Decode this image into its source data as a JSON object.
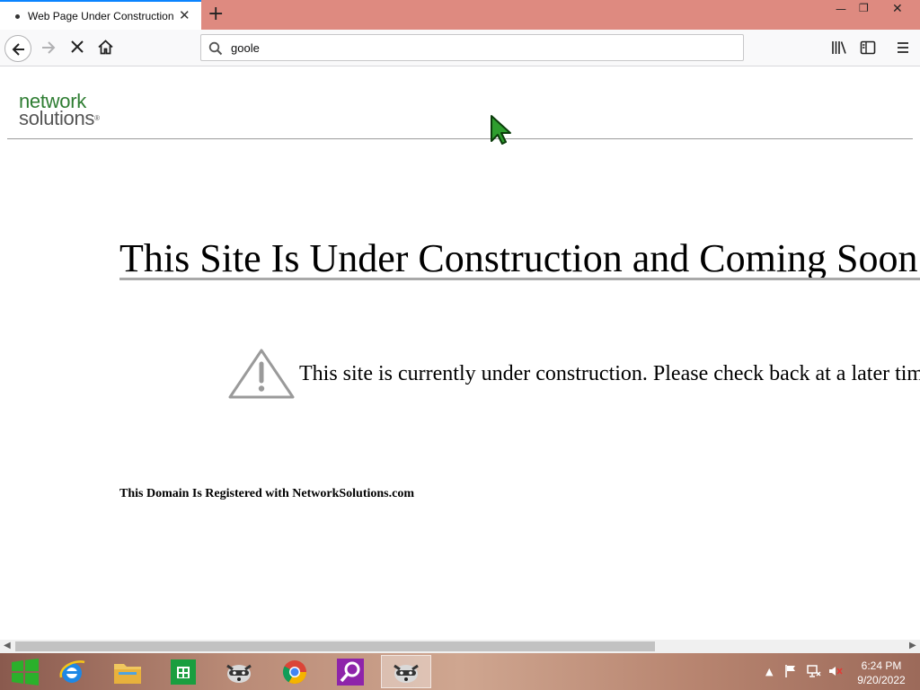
{
  "browser": {
    "tab": {
      "title": "Web Page Under Construction"
    },
    "url_text": "goole"
  },
  "page": {
    "logo": {
      "line1": "network",
      "line2": "solutions",
      "mark": "®"
    },
    "headline": "This Site Is Under Construction and Coming Soon.",
    "notice": "This site is currently under construction. Please check back at a later time.",
    "registered_note": "This Domain Is Registered with NetworkSolutions.com"
  },
  "taskbar": {
    "apps": [
      "start",
      "internet-explorer",
      "file-explorer",
      "store",
      "raccoon-app",
      "chrome",
      "search-app",
      "raccoon-app-active"
    ],
    "clock": {
      "time": "6:24 PM",
      "date": "9/20/2022"
    }
  },
  "colors": {
    "tabbar_bg": "#de8a80",
    "logo_green": "#2e7d32",
    "accent": "#0a84ff"
  }
}
